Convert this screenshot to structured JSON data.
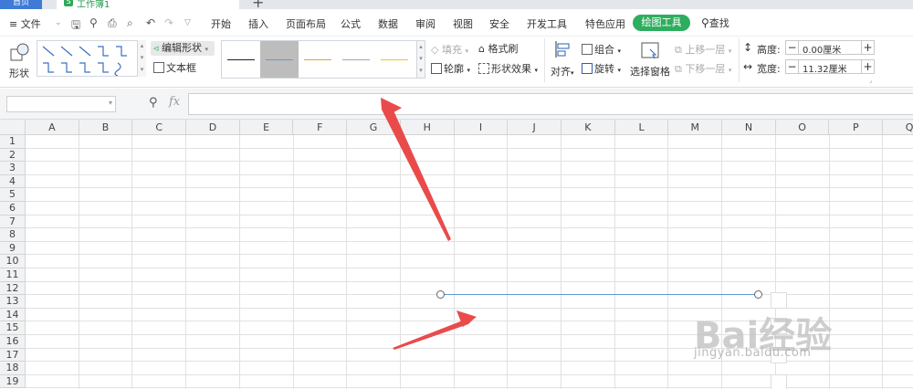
{
  "tabs": {
    "home": "首页",
    "document": "工作簿1",
    "new_tab": "+"
  },
  "menu": {
    "file": "≡ 文件",
    "items": [
      "开始",
      "插入",
      "页面布局",
      "公式",
      "数据",
      "审阅",
      "视图",
      "安全",
      "开发工具",
      "特色应用"
    ],
    "active": "绘图工具",
    "search": "查找"
  },
  "ribbon": {
    "shape": "形状",
    "edit_shape": "编辑形状",
    "text_box": "文本框",
    "fill": "填充",
    "format_painter": "格式刷",
    "outline": "轮廓",
    "shape_effects": "形状效果",
    "align": "对齐",
    "group": "组合",
    "rotate": "旋转",
    "selection_pane": "选择窗格",
    "bring_forward": "上移一层",
    "send_backward": "下移一层",
    "height_label": "高度:",
    "height_value": "0.00厘米",
    "width_label": "宽度:",
    "width_value": "11.32厘米",
    "minus": "−",
    "plus": "+",
    "style_colors": [
      "#222222",
      "#5b9bd5",
      "#e6a23c",
      "#a5a5a5",
      "#f2c811"
    ]
  },
  "formula_bar": {
    "fx": "fx"
  },
  "grid": {
    "columns": [
      "A",
      "B",
      "C",
      "D",
      "E",
      "F",
      "G",
      "H",
      "I",
      "J",
      "K",
      "L",
      "M",
      "N",
      "O",
      "P",
      "Q"
    ],
    "rows": [
      "1",
      "2",
      "3",
      "4",
      "5",
      "6",
      "7",
      "8",
      "9",
      "10",
      "11",
      "12",
      "13",
      "14",
      "15",
      "16",
      "17",
      "18",
      "19"
    ]
  },
  "watermark": {
    "brand": "Bai经验",
    "url": "jingyan.baidu.com"
  },
  "colors": {
    "accent_green": "#2dae5f",
    "shape_line": "#5b9bd5",
    "arrow": "#e94b4b"
  }
}
